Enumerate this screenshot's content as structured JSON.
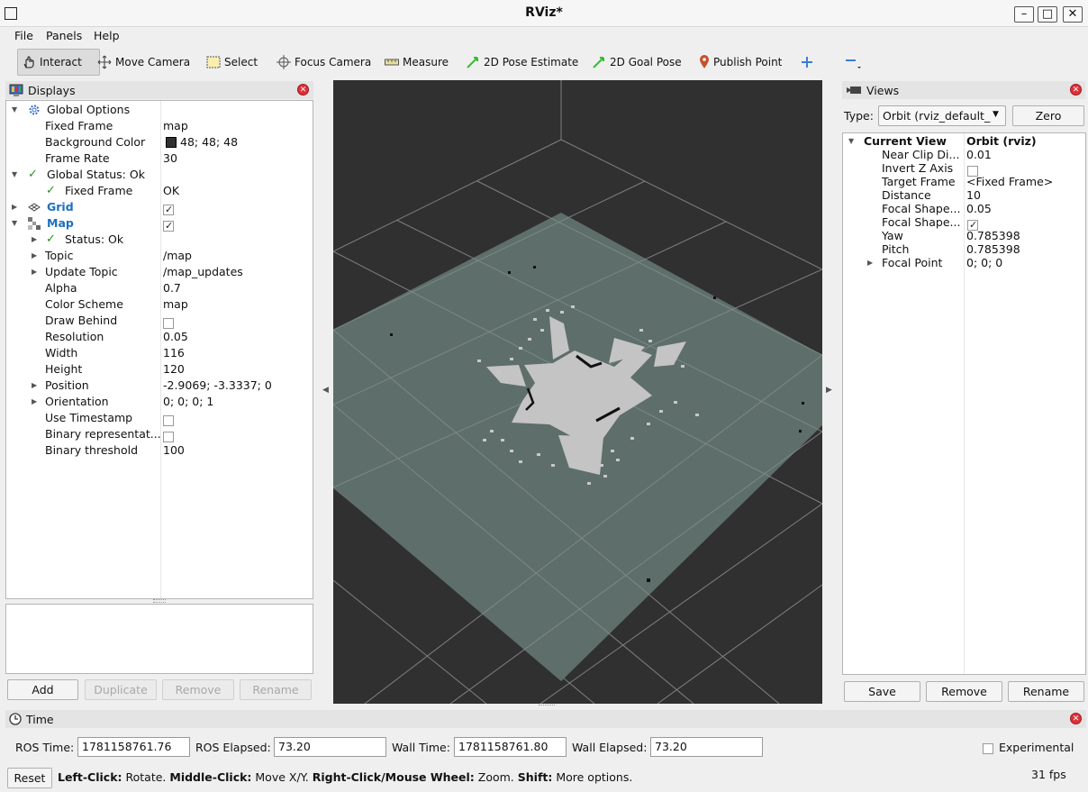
{
  "window": {
    "title": "RViz*"
  },
  "menu": [
    "File",
    "Panels",
    "Help"
  ],
  "toolbar": {
    "interact": "Interact",
    "move_camera": "Move Camera",
    "select": "Select",
    "focus_camera": "Focus Camera",
    "measure": "Measure",
    "pose_estimate": "2D Pose Estimate",
    "goal_pose": "2D Goal Pose",
    "publish_point": "Publish Point"
  },
  "displays": {
    "title": "Displays",
    "rows": [
      {
        "label": "Global Options",
        "value": ""
      },
      {
        "label": "Fixed Frame",
        "value": "map"
      },
      {
        "label": "Background Color",
        "value": "48; 48; 48"
      },
      {
        "label": "Frame Rate",
        "value": "30"
      },
      {
        "label": "Global Status: Ok",
        "value": ""
      },
      {
        "label": "Fixed Frame",
        "value": "OK"
      },
      {
        "label": "Grid",
        "value": ""
      },
      {
        "label": "Map",
        "value": ""
      },
      {
        "label": "Status: Ok",
        "value": ""
      },
      {
        "label": "Topic",
        "value": "/map"
      },
      {
        "label": "Update Topic",
        "value": "/map_updates"
      },
      {
        "label": "Alpha",
        "value": "0.7"
      },
      {
        "label": "Color Scheme",
        "value": "map"
      },
      {
        "label": "Draw Behind",
        "value": ""
      },
      {
        "label": "Resolution",
        "value": "0.05"
      },
      {
        "label": "Width",
        "value": "116"
      },
      {
        "label": "Height",
        "value": "120"
      },
      {
        "label": "Position",
        "value": "-2.9069; -3.3337; 0"
      },
      {
        "label": "Orientation",
        "value": "0; 0; 0; 1"
      },
      {
        "label": "Use Timestamp",
        "value": ""
      },
      {
        "label": "Binary representat...",
        "value": ""
      },
      {
        "label": "Binary threshold",
        "value": "100"
      }
    ],
    "buttons": {
      "add": "Add",
      "duplicate": "Duplicate",
      "remove": "Remove",
      "rename": "Rename"
    }
  },
  "views": {
    "title": "Views",
    "type_label": "Type:",
    "type_value": "Orbit (rviz_default_",
    "zero": "Zero",
    "header": {
      "label": "Current View",
      "value": "Orbit (rviz)"
    },
    "rows": [
      {
        "label": "Near Clip Di...",
        "value": "0.01"
      },
      {
        "label": "Invert Z Axis",
        "value": ""
      },
      {
        "label": "Target Frame",
        "value": "<Fixed Frame>"
      },
      {
        "label": "Distance",
        "value": "10"
      },
      {
        "label": "Focal Shape...",
        "value": "0.05"
      },
      {
        "label": "Focal Shape...",
        "value": ""
      },
      {
        "label": "Yaw",
        "value": "0.785398"
      },
      {
        "label": "Pitch",
        "value": "0.785398"
      },
      {
        "label": "Focal Point",
        "value": "0; 0; 0"
      }
    ],
    "buttons": {
      "save": "Save",
      "remove": "Remove",
      "rename": "Rename"
    }
  },
  "time": {
    "title": "Time",
    "ros_time_label": "ROS Time:",
    "ros_time": "1781158761.76",
    "ros_elapsed_label": "ROS Elapsed:",
    "ros_elapsed": "73.20",
    "wall_time_label": "Wall Time:",
    "wall_time": "1781158761.80",
    "wall_elapsed_label": "Wall Elapsed:",
    "wall_elapsed": "73.20",
    "experimental": "Experimental"
  },
  "status": {
    "reset": "Reset",
    "left_click": "Left-Click:",
    "rotate": " Rotate. ",
    "middle_click": "Middle-Click:",
    "move": " Move X/Y. ",
    "right_click": "Right-Click/Mouse Wheel:",
    "zoom": " Zoom. ",
    "shift": "Shift:",
    "more": " More options.",
    "fps": "31 fps"
  },
  "colors": {
    "viewport_bg": "#303030",
    "map_fill": "#5e6e6a",
    "grid": "#a0a0a0",
    "close": "#e0303a"
  }
}
